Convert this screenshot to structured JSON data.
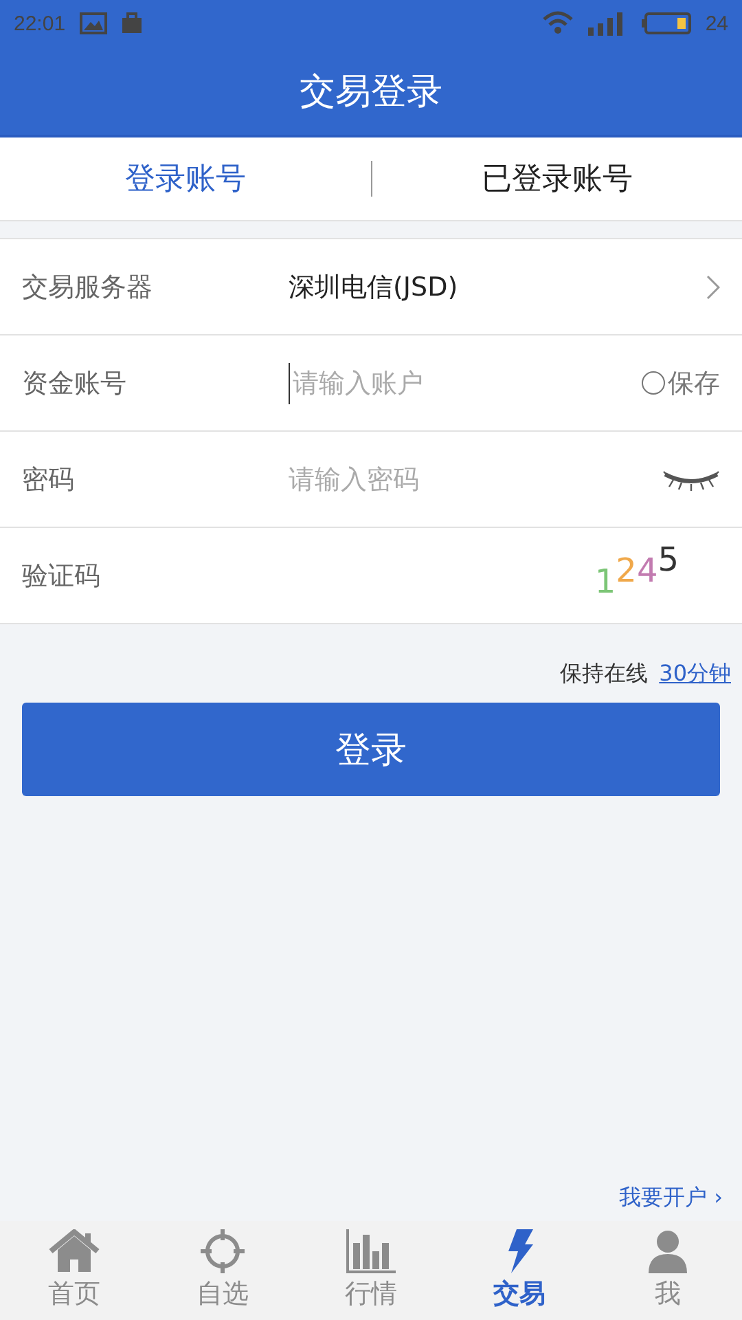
{
  "status_bar": {
    "time": "22:01",
    "battery": "24"
  },
  "header": {
    "title": "交易登录"
  },
  "tabs": [
    {
      "label": "登录账号",
      "selected": true
    },
    {
      "label": "已登录账号",
      "selected": false
    }
  ],
  "form": [
    {
      "kind": "select",
      "label": "交易服务器",
      "value": "深圳电信(JSD)"
    },
    {
      "kind": "account",
      "label": "资金账号",
      "placeholder": "请输入账户",
      "save": {
        "label": "保存",
        "checked": false
      }
    },
    {
      "kind": "password",
      "label": "密码",
      "placeholder": "请输入密码"
    },
    {
      "kind": "captcha",
      "label": "验证码",
      "digits": [
        {
          "text": "1",
          "color": "#7cc576"
        },
        {
          "text": "2",
          "color": "#f0a84a"
        },
        {
          "text": "4",
          "color": "#c27bb0"
        },
        {
          "text": "5",
          "color": "#333333"
        }
      ]
    }
  ],
  "keep_online": {
    "label": "保持在线",
    "link": "30分钟"
  },
  "login_button": "登录",
  "open_account": "我要开户 ›",
  "nav": [
    {
      "label": "首页",
      "selected": false
    },
    {
      "label": "自选",
      "selected": false
    },
    {
      "label": "行情",
      "selected": false
    },
    {
      "label": "交易",
      "selected": true
    },
    {
      "label": "我",
      "selected": false
    }
  ]
}
